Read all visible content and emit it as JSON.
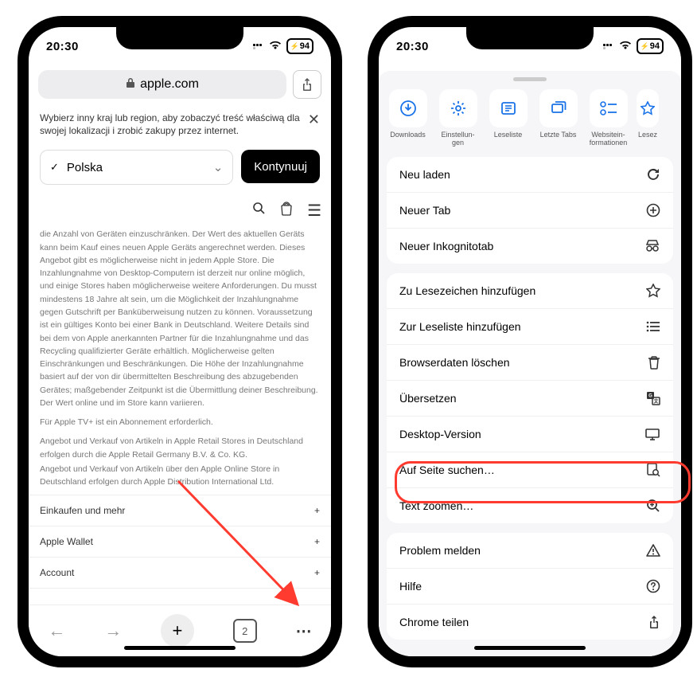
{
  "status": {
    "time": "20:30",
    "battery": "94"
  },
  "left": {
    "url": "apple.com",
    "banner": "Wybierz inny kraj lub region, aby zobaczyć treść właściwą dla swojej lokalizacji i zrobić zakupy przez internet.",
    "country": "Polska",
    "continue": "Kontynuuj",
    "legal": "die Anzahl von Geräten einzuschränken. Der Wert des aktuellen Geräts kann beim Kauf eines neuen Apple Geräts angerechnet werden. Dieses Angebot gibt es möglicherweise nicht in jedem Apple Store. Die Inzahlungnahme von Desktop-Computern ist derzeit nur online möglich, und einige Stores haben möglicherweise weitere Anforderungen. Du musst mindestens 18 Jahre alt sein, um die Möglichkeit der Inzahlungnahme gegen Gutschrift per Banküberweisung nutzen zu können. Voraussetzung ist ein gültiges Konto bei einer Bank in Deutschland. Weitere Details sind bei dem von Apple anerkannten Partner für die Inzahlungnahme und das Recycling qualifizierter Geräte erhältlich. Möglicherweise gelten Einschränkungen und Beschränkungen. Die Höhe der Inzahlungnahme basiert auf der von dir übermittelten Beschreibung des abzugebenden Gerätes; maßgebender Zeitpunkt ist die Übermittlung deiner Beschreibung. Der Wert online und im Store kann variieren.",
    "tvplus": "Für Apple TV+ ist ein Abonnement erforderlich.",
    "retail1": "Angebot und Verkauf von Artikeln in Apple Retail Stores in Deutschland erfolgen durch die Apple Retail Germany B.V. & Co. KG.",
    "retail2": "Angebot und Verkauf von Artikeln über den Apple Online Store in Deutschland erfolgen durch Apple Distribution International Ltd.",
    "accordion": [
      "Einkaufen und mehr",
      "Apple Wallet",
      "Account"
    ],
    "tabcount": "2"
  },
  "right": {
    "quick": [
      {
        "label": "Downloads"
      },
      {
        "label": "Einstellun-\ngen"
      },
      {
        "label": "Leseliste"
      },
      {
        "label": "Letzte Tabs"
      },
      {
        "label": "Websitein-\nformationen"
      },
      {
        "label": "Lesez"
      }
    ],
    "card1": [
      {
        "t": "Neu laden",
        "i": "reload"
      },
      {
        "t": "Neuer Tab",
        "i": "plus"
      },
      {
        "t": "Neuer Inkognitotab",
        "i": "incognito"
      }
    ],
    "card2": [
      {
        "t": "Zu Lesezeichen hinzufügen",
        "i": "star"
      },
      {
        "t": "Zur Leseliste hinzufügen",
        "i": "readlist"
      },
      {
        "t": "Browserdaten löschen",
        "i": "trash"
      },
      {
        "t": "Übersetzen",
        "i": "translate"
      },
      {
        "t": "Desktop-Version",
        "i": "desktop"
      },
      {
        "t": "Auf Seite suchen…",
        "i": "findpage",
        "hl": true
      },
      {
        "t": "Text zoomen…",
        "i": "zoom"
      }
    ],
    "card3": [
      {
        "t": "Problem melden",
        "i": "warn"
      },
      {
        "t": "Hilfe",
        "i": "help"
      },
      {
        "t": "Chrome teilen",
        "i": "share"
      }
    ]
  }
}
